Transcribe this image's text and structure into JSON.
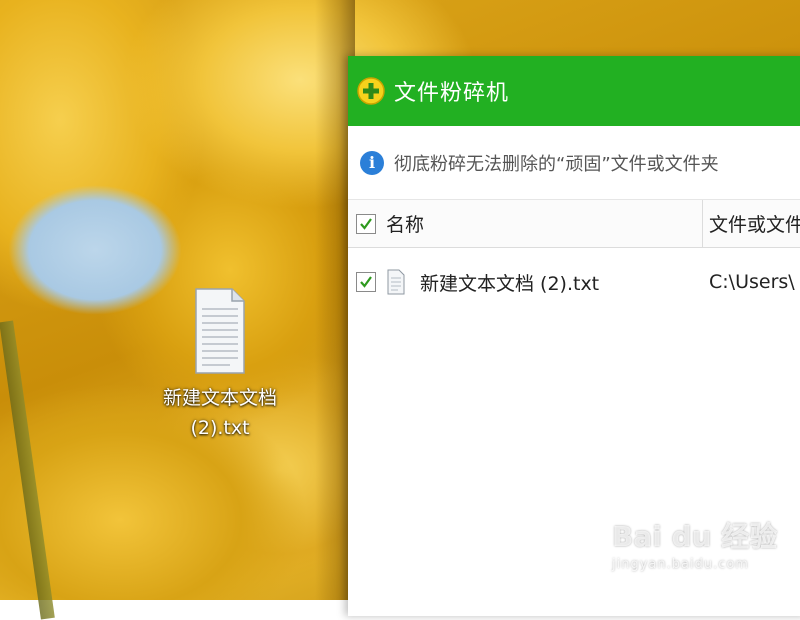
{
  "desktop": {
    "file_icon": {
      "name": "doc-file-icon",
      "label": "新建文本文档 (2).txt"
    }
  },
  "window": {
    "title": "文件粉碎机",
    "app_icon": "plus-circle-icon",
    "accent_color": "#22b022",
    "info": {
      "icon": "info-icon",
      "text": "彻底粉碎无法删除的“顽固”文件或文件夹"
    },
    "table": {
      "columns": [
        "名称",
        "文件或文件夹"
      ],
      "header_checked": true,
      "rows": [
        {
          "checked": true,
          "name": "新建文本文档 (2).txt",
          "path": "C:\\Users\\"
        }
      ]
    }
  },
  "watermark": {
    "logo_text": "Bai du 经验",
    "url": "jingyan.baidu.com"
  }
}
